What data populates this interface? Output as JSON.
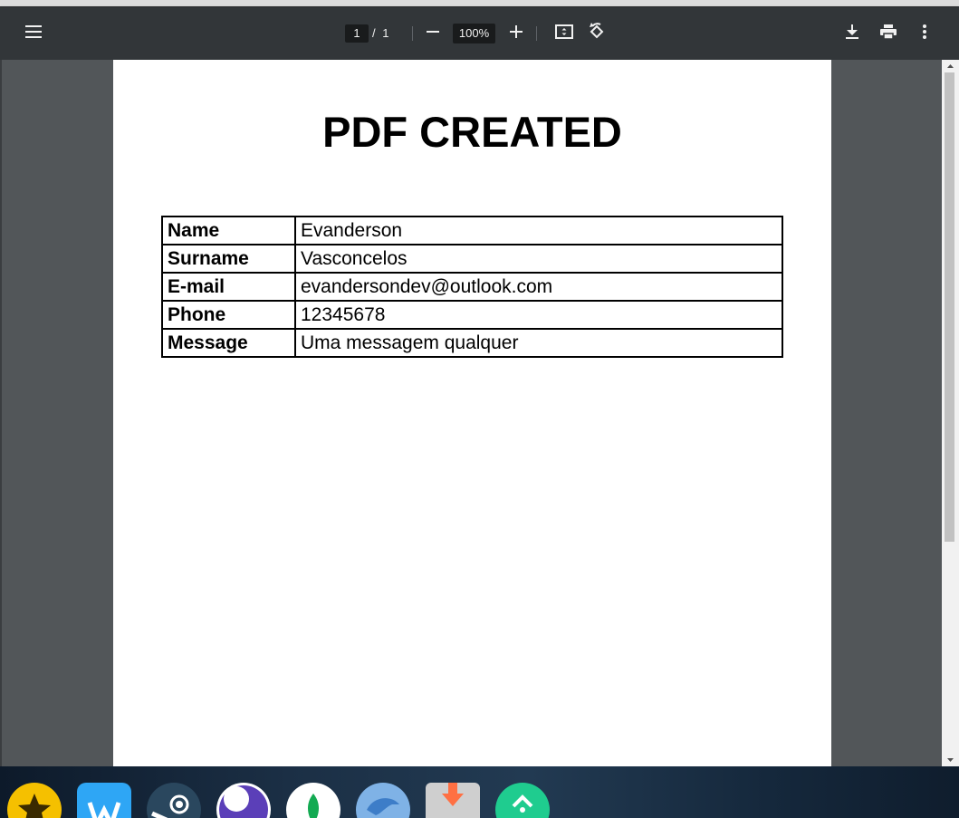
{
  "toolbar": {
    "page_current": "1",
    "page_separator": "/",
    "page_total": "1",
    "zoom_value": "100%"
  },
  "document": {
    "title": "PDF CREATED",
    "rows": [
      {
        "label": "Name",
        "value": "Evanderson"
      },
      {
        "label": "Surname",
        "value": "Vasconcelos"
      },
      {
        "label": "E-mail",
        "value": "evandersondev@outlook.com"
      },
      {
        "label": "Phone",
        "value": "12345678"
      },
      {
        "label": "Message",
        "value": "Uma messagem qualquer"
      }
    ]
  },
  "taskbar": {
    "apps": [
      {
        "icon": "star-app-icon",
        "color": "#f5c000"
      },
      {
        "icon": "w-app-icon",
        "color": "#2ea6f5"
      },
      {
        "icon": "steam-icon",
        "color": "#2a475e"
      },
      {
        "icon": "moon-app-icon",
        "color": "#5b3fb8"
      },
      {
        "icon": "mongodb-leaf-icon",
        "color": "#ffffff"
      },
      {
        "icon": "dolphin-icon",
        "color": "#3d7dc8"
      },
      {
        "icon": "download-app-icon",
        "color": "#ff7043"
      },
      {
        "icon": "chevron-up-app-icon",
        "color": "#1fcc8f"
      }
    ]
  },
  "colors": {
    "toolbar_bg": "#323639",
    "viewer_bg": "#525659",
    "page_bg": "#ffffff"
  }
}
